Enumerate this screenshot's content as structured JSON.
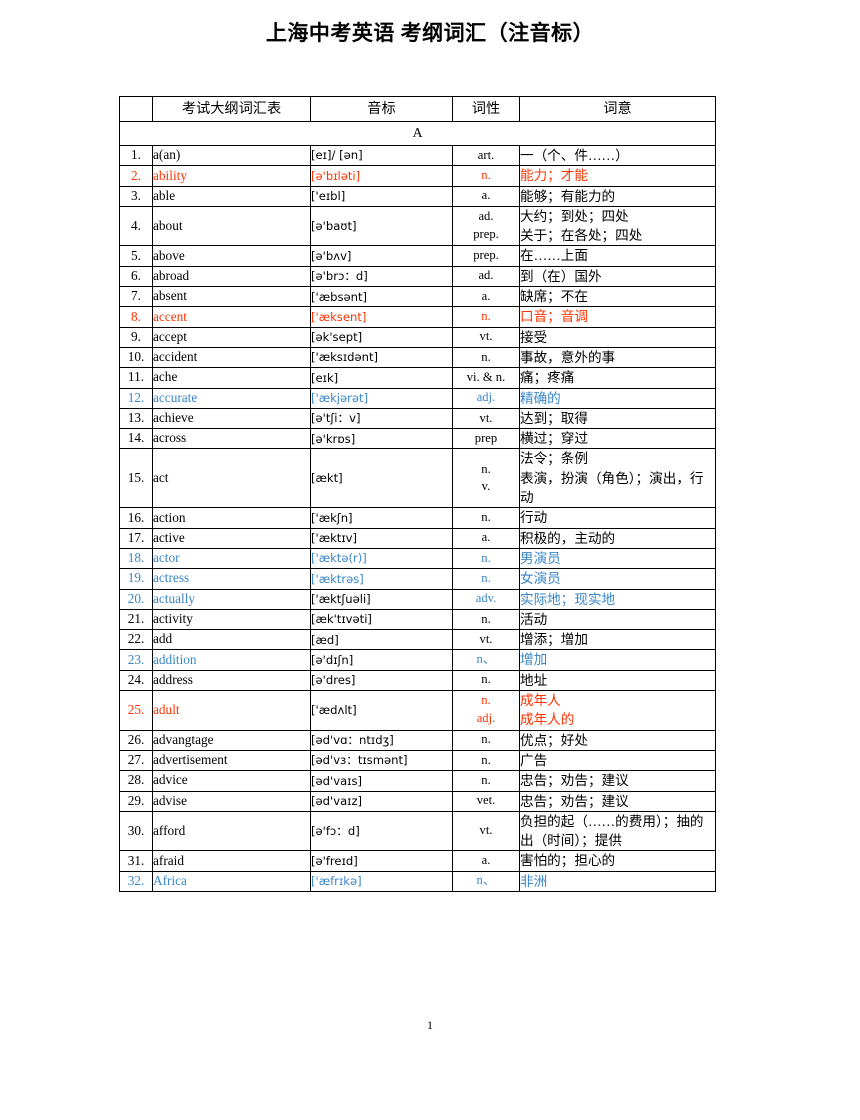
{
  "document": {
    "title": "上海中考英语 考纲词汇（注音标）",
    "page_number": "1"
  },
  "colors": {
    "red": "#FF3300",
    "blue": "#3A87C8",
    "text": "#000000",
    "border": "#000000"
  },
  "table": {
    "headers": {
      "index": "",
      "word": "考试大纲词汇表",
      "phonetic": "音标",
      "pos": "词性",
      "meaning": "词意"
    },
    "section_label": "A",
    "rows": [
      {
        "num": "1.",
        "word": "a(an)",
        "ipa": "[eɪ]/ [ən]",
        "pos": [
          "art."
        ],
        "meaning": [
          "一（个、件……）"
        ],
        "style": "plain"
      },
      {
        "num": "2.",
        "word": "ability",
        "ipa": "[ə'bɪləti]",
        "pos": [
          "n."
        ],
        "meaning": [
          "能力；才能"
        ],
        "style": "red-bold"
      },
      {
        "num": "3.",
        "word": "able",
        "ipa": "['eɪbl]",
        "pos": [
          "a."
        ],
        "meaning": [
          "能够；有能力的"
        ],
        "style": "plain"
      },
      {
        "num": "4.",
        "word": "about",
        "ipa": "[ə'baʊt]",
        "pos": [
          "ad.",
          "prep."
        ],
        "meaning": [
          "大约；到处；四处",
          "关于；在各处；四处"
        ],
        "style": "plain"
      },
      {
        "num": "5.",
        "word": "above",
        "ipa": "[ə'bʌv]",
        "pos": [
          "prep."
        ],
        "meaning": [
          "在……上面"
        ],
        "style": "plain"
      },
      {
        "num": "6.",
        "word": "abroad",
        "ipa": "[ə'brɔ：d]",
        "pos": [
          "ad."
        ],
        "meaning": [
          "到（在）国外"
        ],
        "style": "plain"
      },
      {
        "num": "7.",
        "word": "absent",
        "ipa": "['æbsənt]",
        "pos": [
          "a."
        ],
        "meaning": [
          "缺席；不在"
        ],
        "style": "plain"
      },
      {
        "num": "8.",
        "word": "accent",
        "ipa": "['æksent]",
        "pos": [
          "n."
        ],
        "meaning": [
          "口音；音调"
        ],
        "style": "red-bold"
      },
      {
        "num": "9.",
        "word": "accept",
        "ipa": "[ək'sept]",
        "pos": [
          "vt."
        ],
        "meaning": [
          "接受"
        ],
        "style": "plain"
      },
      {
        "num": "10.",
        "word": "accident",
        "ipa": "['æksɪdənt]",
        "pos": [
          "n."
        ],
        "meaning": [
          "事故，意外的事"
        ],
        "style": "plain"
      },
      {
        "num": "11.",
        "word": "ache",
        "ipa": "[eɪk]",
        "pos": [
          "vi. & n."
        ],
        "meaning": [
          "痛；疼痛"
        ],
        "style": "plain"
      },
      {
        "num": "12.",
        "word": "accurate",
        "ipa": "['ækjərət]",
        "pos": [
          "adj."
        ],
        "meaning": [
          "精确的"
        ],
        "style": "blue"
      },
      {
        "num": "13.",
        "word": "achieve",
        "ipa": "[ə'tʃi：v]",
        "pos": [
          "vt."
        ],
        "meaning": [
          "达到；取得"
        ],
        "style": "plain"
      },
      {
        "num": "14.",
        "word": "across",
        "ipa": "[ə'krɒs]",
        "pos": [
          "prep"
        ],
        "meaning": [
          "横过；穿过"
        ],
        "style": "plain"
      },
      {
        "num": "15.",
        "word": "act",
        "ipa": "[ækt]",
        "pos": [
          "n.",
          "v."
        ],
        "meaning": [
          "法令；条例",
          "表演，扮演（角色）；演出，行动"
        ],
        "style": "plain",
        "wrap_last": true
      },
      {
        "num": "16.",
        "word": "action",
        "ipa": "['ækʃn]",
        "pos": [
          "n."
        ],
        "meaning": [
          "行动"
        ],
        "style": "plain"
      },
      {
        "num": "17.",
        "word": "active",
        "ipa": "['æktɪv]",
        "pos": [
          "a."
        ],
        "meaning": [
          "积极的，主动的"
        ],
        "style": "plain"
      },
      {
        "num": "18.",
        "word": "actor",
        "ipa": "['æktə(r)]",
        "pos": [
          "n."
        ],
        "meaning": [
          "男演员"
        ],
        "style": "blue"
      },
      {
        "num": "19.",
        "word": "actress",
        "ipa": "['æktrəs]",
        "pos": [
          "n."
        ],
        "meaning": [
          "女演员"
        ],
        "style": "blue"
      },
      {
        "num": "20.",
        "word": "actually",
        "ipa": "['æktʃuəli]",
        "pos": [
          "adv."
        ],
        "meaning": [
          "实际地；现实地"
        ],
        "style": "blue-ipa-black"
      },
      {
        "num": "21.",
        "word": "activity",
        "ipa": "[æk'tɪvəti]",
        "pos": [
          "n."
        ],
        "meaning": [
          "活动"
        ],
        "style": "plain"
      },
      {
        "num": "22.",
        "word": "add",
        "ipa": "[æd]",
        "pos": [
          "vt."
        ],
        "meaning": [
          "增添；增加"
        ],
        "style": "plain"
      },
      {
        "num": "23.",
        "word": "addition",
        "ipa": "[ə'dɪʃn]",
        "pos": [
          "n、"
        ],
        "meaning": [
          "增加"
        ],
        "style": "blue-ipa-black"
      },
      {
        "num": "24.",
        "word": "address",
        "ipa": "[ə'dres]",
        "pos": [
          "n."
        ],
        "meaning": [
          "地址"
        ],
        "style": "plain"
      },
      {
        "num": "25.",
        "word": "adult",
        "ipa": "['ædʌlt]",
        "pos": [
          "n.",
          "adj."
        ],
        "meaning": [
          "成年人",
          "成年人的"
        ],
        "style": "red-ipa-black"
      },
      {
        "num": "26.",
        "word": "advangtage",
        "ipa": "[əd'vɑ：ntɪdʒ]",
        "pos": [
          "n."
        ],
        "meaning": [
          "优点；好处"
        ],
        "style": "plain"
      },
      {
        "num": "27.",
        "word": "advertisement",
        "ipa": "[əd'vɜ：tɪsmənt]",
        "pos": [
          "n."
        ],
        "meaning": [
          "广告"
        ],
        "style": "plain"
      },
      {
        "num": "28.",
        "word": "advice",
        "ipa": "[əd'vaɪs]",
        "pos": [
          "n."
        ],
        "meaning": [
          "忠告；劝告；建议"
        ],
        "style": "plain"
      },
      {
        "num": "29.",
        "word": "advise",
        "ipa": "[əd'vaɪz]",
        "pos": [
          "vet."
        ],
        "meaning": [
          "忠告；劝告；建议"
        ],
        "style": "plain"
      },
      {
        "num": "30.",
        "word": "afford",
        "ipa": "[ə'fɔ：d]",
        "pos": [
          "vt."
        ],
        "meaning": [
          "负担的起（……的费用）；抽的出（时间）；提供"
        ],
        "style": "plain",
        "wrap_last": true
      },
      {
        "num": "31.",
        "word": "afraid",
        "ipa": "[ə'freɪd]",
        "pos": [
          "a."
        ],
        "meaning": [
          "害怕的；担心的"
        ],
        "style": "plain"
      },
      {
        "num": "32.",
        "word": "Africa",
        "ipa": "['æfrɪkə]",
        "pos": [
          "n、"
        ],
        "meaning": [
          "非洲"
        ],
        "style": "blue"
      }
    ]
  }
}
